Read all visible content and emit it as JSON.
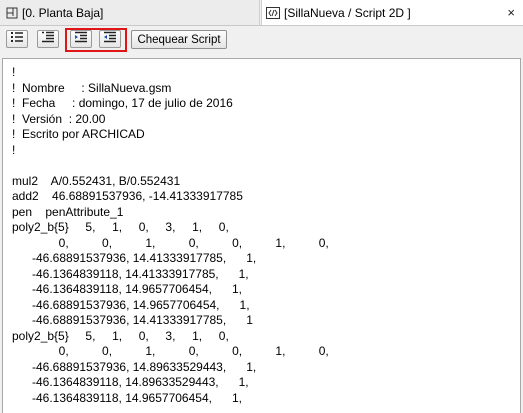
{
  "tabs": {
    "left": {
      "label": "[0. Planta Baja]",
      "icon": "floor-plan-icon"
    },
    "right": {
      "label": "[SillaNueva / Script 2D ]",
      "icon": "script-code-icon",
      "close": "×"
    }
  },
  "toolbar": {
    "buttons": [
      {
        "icon": "list-bullet-icon"
      },
      {
        "icon": "list-align-icon"
      },
      {
        "icon": "indent-increase-icon"
      },
      {
        "icon": "indent-decrease-icon"
      }
    ],
    "check_label": "Chequear Script",
    "highlight_color": "#e01515"
  },
  "editor": {
    "lines": [
      "!",
      "!  Nombre     : SillaNueva.gsm",
      "!  Fecha     : domingo, 17 de julio de 2016",
      "!  Versión  : 20.00",
      "!  Escrito por ARCHICAD",
      "!",
      "",
      "mul2    A/0.552431, B/0.552431",
      "add2    46.68891537936, -14.41333917785",
      "pen    penAttribute_1",
      "poly2_b{5}     5,     1,     0,     3,     1,     0,",
      "              0,          0,          1,          0,          0,          1,          0,",
      "      -46.68891537936, 14.41333917785,      1,",
      "      -46.1364839118, 14.41333917785,      1,",
      "      -46.1364839118, 14.9657706454,      1,",
      "      -46.68891537936, 14.9657706454,      1,",
      "      -46.68891537936, 14.41333917785,      1",
      "poly2_b{5}     5,     1,     0,     3,     1,     0,",
      "              0,          0,          1,          0,          0,          1,          0,",
      "      -46.68891537936, 14.89633529443,      1,",
      "      -46.1364839118, 14.89633529443,      1,",
      "      -46.1364839118, 14.9657706454,      1,"
    ]
  }
}
